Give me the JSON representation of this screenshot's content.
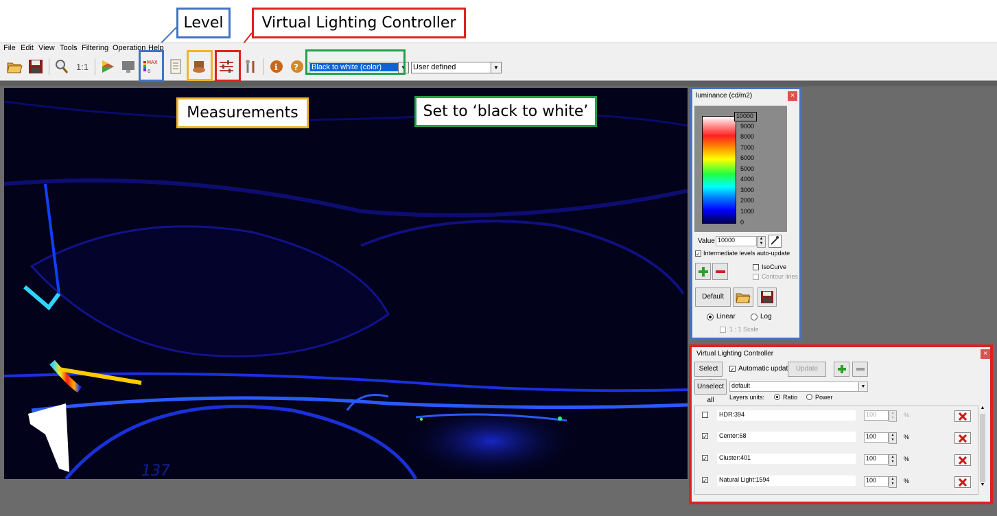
{
  "annotations": {
    "level": {
      "label": "Level",
      "color": "#4472c4"
    },
    "vlc": {
      "label": "Virtual Lighting Controller",
      "color": "#e02020"
    },
    "measurements": {
      "label": "Measurements",
      "color": "#f0b429"
    },
    "set_bw": {
      "label": "Set to ‘black to white’",
      "color": "#22a04a"
    }
  },
  "menu": [
    "File",
    "Edit",
    "View",
    "Tools",
    "Filtering",
    "Operation",
    "Help"
  ],
  "toolbar": {
    "colormap_select": "Black to white (color)",
    "scale_select": "User defined",
    "icons": [
      "open-folder-icon",
      "save-disk-icon",
      "zoom-magnifier-icon",
      "one-to-one-icon",
      "color-palette-icon",
      "monitor-icon",
      "level-icon",
      "report-icon",
      "measurements-icon",
      "vlc-sliders-icon",
      "tools-icon",
      "info-icon",
      "help-icon"
    ],
    "one_to_one": "1:1"
  },
  "luminance_panel": {
    "title": "luminance (cd/m2)",
    "top_value": "10000",
    "ticks": [
      "9000",
      "8000",
      "7000",
      "6000",
      "5000",
      "4000",
      "3000",
      "2000",
      "1000",
      "0"
    ],
    "value_label": "Value",
    "value": "10000",
    "auto_update_label": "Intermediate levels auto-update",
    "isocurve_label": "IsoCurve",
    "contour_label": "Contour lines",
    "default_label": "Default",
    "linear_label": "Linear",
    "log_label": "Log",
    "scale_label": "1 : 1 Scale",
    "scale_mode": "Linear"
  },
  "vlc_panel": {
    "title": "Virtual Lighting Controller",
    "select_all": "Select all",
    "unselect_all": "Unselect all",
    "automatic_update": "Automatic update",
    "update": "Update",
    "preset": "default",
    "layers_units_label": "Layers units:",
    "ratio_label": "Ratio",
    "power_label": "Power",
    "layers": [
      {
        "name": "HDR:394",
        "value": "100",
        "unit": "%",
        "checked": false
      },
      {
        "name": "Center:68",
        "value": "100",
        "unit": "%",
        "checked": true
      },
      {
        "name": "Cluster:401",
        "value": "100",
        "unit": "%",
        "checked": true
      },
      {
        "name": "Natural Light:1594",
        "value": "100",
        "unit": "%",
        "checked": true
      }
    ]
  },
  "image": {
    "odometer": "137"
  },
  "colors": {
    "toolbar_bg": "#f0f0f0",
    "app_bg": "#6b6b6b",
    "image_bg": "#02021a",
    "selection": "#0a64d8"
  }
}
